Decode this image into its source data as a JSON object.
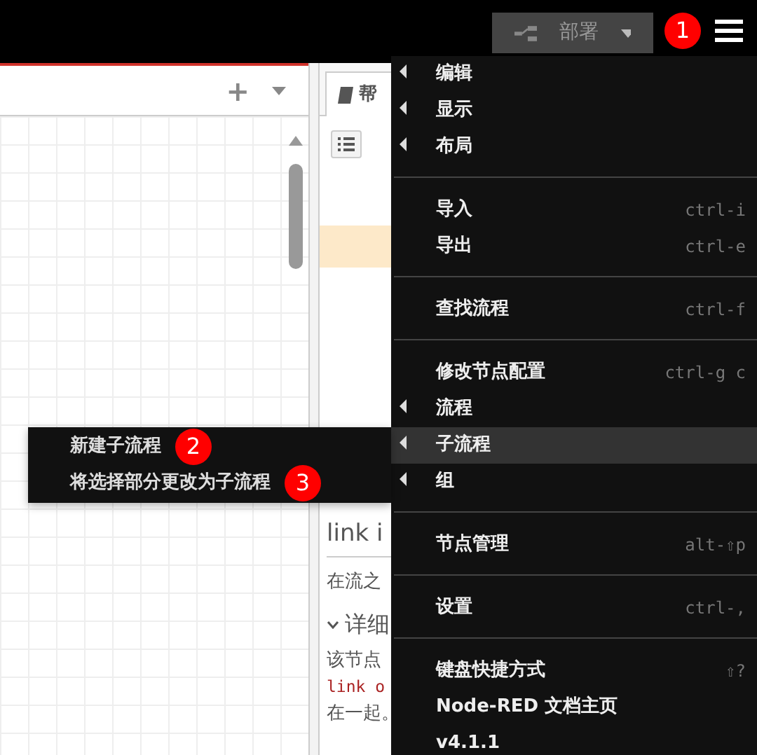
{
  "header": {
    "deploy": {
      "label": "部署"
    },
    "badge": "1"
  },
  "canvas": {
    "tab_actions": [
      "+"
    ]
  },
  "sidebar": {
    "tab": {
      "label": "帮",
      "selected": true
    },
    "help": {
      "title": "link i",
      "intro": "在流之",
      "section": "详细",
      "section_expanded": true,
      "lines": [
        {
          "kind": "text",
          "text": "该节点"
        },
        {
          "kind": "code",
          "text": "link o"
        },
        {
          "kind": "text",
          "text": "在一起。"
        }
      ]
    }
  },
  "main_menu": [
    {
      "kind": "item",
      "label": "编辑",
      "submenu": true,
      "selected": false
    },
    {
      "kind": "item",
      "label": "显示",
      "submenu": true,
      "selected": false
    },
    {
      "kind": "item",
      "label": "布局",
      "submenu": true,
      "selected": false
    },
    {
      "kind": "divider"
    },
    {
      "kind": "item",
      "label": "导入",
      "shortcut": "ctrl-i",
      "submenu": false,
      "selected": false
    },
    {
      "kind": "item",
      "label": "导出",
      "shortcut": "ctrl-e",
      "submenu": false,
      "selected": false
    },
    {
      "kind": "divider"
    },
    {
      "kind": "item",
      "label": "查找流程",
      "shortcut": "ctrl-f",
      "submenu": false,
      "selected": false
    },
    {
      "kind": "divider"
    },
    {
      "kind": "item",
      "label": "修改节点配置",
      "shortcut": "ctrl-g c",
      "submenu": false,
      "selected": false
    },
    {
      "kind": "item",
      "label": "流程",
      "submenu": true,
      "selected": false
    },
    {
      "kind": "item",
      "label": "子流程",
      "submenu": true,
      "selected": true
    },
    {
      "kind": "item",
      "label": "组",
      "submenu": true,
      "selected": false
    },
    {
      "kind": "divider"
    },
    {
      "kind": "item",
      "label": "节点管理",
      "shortcut": "alt-⇧p",
      "submenu": false,
      "selected": false
    },
    {
      "kind": "divider"
    },
    {
      "kind": "item",
      "label": "设置",
      "shortcut": "ctrl-,",
      "submenu": false,
      "selected": false
    },
    {
      "kind": "divider"
    },
    {
      "kind": "item",
      "label": "键盘快捷方式",
      "shortcut": "⇧?",
      "submenu": false,
      "selected": false
    },
    {
      "kind": "item",
      "label": "Node-RED 文档主页",
      "submenu": false,
      "selected": false
    },
    {
      "kind": "item",
      "label": "v4.1.1",
      "submenu": false,
      "selected": false
    }
  ],
  "submenu": [
    {
      "label": "新建子流程",
      "badge": "2"
    },
    {
      "label": "将选择部分更改为子流程",
      "badge": "3"
    }
  ]
}
